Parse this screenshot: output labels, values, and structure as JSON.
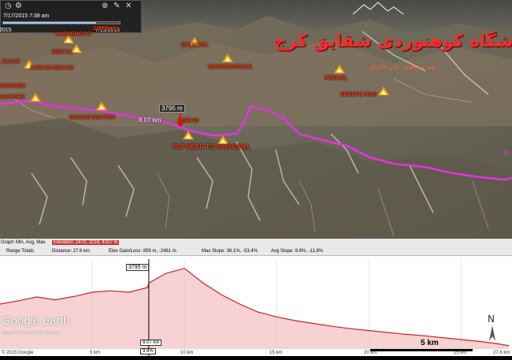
{
  "timebar": {
    "current_time": "7/17/2015 7:38 am",
    "start_date": "2015",
    "end_date": "7/19/2015",
    "progress": 0.8
  },
  "overlay": {
    "title_fa": "باشگاه کوهنوردی شقایق کرج",
    "subtitle_fa": "تهیه و تنظیم: علی حاجیلو",
    "distance_label": "8.07 km",
    "elevation_callout": "3795 m"
  },
  "peaks": [
    {
      "label": "KHOLEHGOO"
    },
    {
      "label": "SORSHAL"
    },
    {
      "label": "MISHAL"
    },
    {
      "label": "DALKOOL"
    },
    {
      "label": "SARKOUSBANG"
    },
    {
      "label": "ALVAN"
    },
    {
      "label": "NOGHRBOTDAR"
    },
    {
      "label": "RECHAL"
    },
    {
      "label": "BANGEBI"
    },
    {
      "label": "GARGHO"
    },
    {
      "label": "SEKEYE HOO"
    },
    {
      "label": "GAVANPOSHTEH"
    },
    {
      "label": "DORHO"
    },
    {
      "label": "TOP NEAR TO YAKHCHAL"
    }
  ],
  "stats": {
    "graph_label": "Graph",
    "min_avg_max": "Min, Avg, Max",
    "elevation": "Elevation: 2470, 3218, 4107 m",
    "range_totals": "Range Totals",
    "distance": "Distance: 27.6 km",
    "gain_loss": "Elev Gain/Loss: 858 m, -2461 m",
    "max_slope": "Max Slope: 36.1%, -53.4%",
    "avg_slope": "Avg Slope: 9.8%, -11.8%"
  },
  "profile": {
    "cursor_elevation": "3795 m",
    "cursor_distance": "8.07 km",
    "cursor_slope": "9.9%",
    "xticks": [
      "5 km",
      "10 km",
      "15 km",
      "20 km",
      "25 km",
      "27.6 km"
    ]
  },
  "branding": {
    "logo": "Google earth",
    "imagery": "Image © 2015 CNES / Astrium",
    "copyright": "© 2015 Google",
    "scale_label": "5 km"
  },
  "chart_data": {
    "type": "area",
    "x": [
      0,
      1,
      2,
      3,
      4,
      5,
      6,
      7,
      8,
      8.07,
      9,
      10,
      11,
      12,
      13,
      14,
      15,
      16,
      17,
      18,
      19,
      20,
      21,
      22,
      23,
      24,
      25,
      26,
      27,
      27.6
    ],
    "y": [
      3350,
      3420,
      3500,
      3440,
      3510,
      3600,
      3630,
      3600,
      3700,
      3795,
      4000,
      4107,
      3800,
      3550,
      3350,
      3180,
      3080,
      3000,
      2940,
      2880,
      2830,
      2790,
      2750,
      2710,
      2680,
      2640,
      2600,
      2560,
      2510,
      2470
    ],
    "xlim": [
      0,
      27.6
    ],
    "ylim": [
      2470,
      4107
    ],
    "series_color": "#cc2222",
    "fill_color": "#f7d2d2"
  },
  "colors": {
    "track": "#e830e8",
    "peak_label": "#ff3c14",
    "title": "#ff2a2a"
  }
}
